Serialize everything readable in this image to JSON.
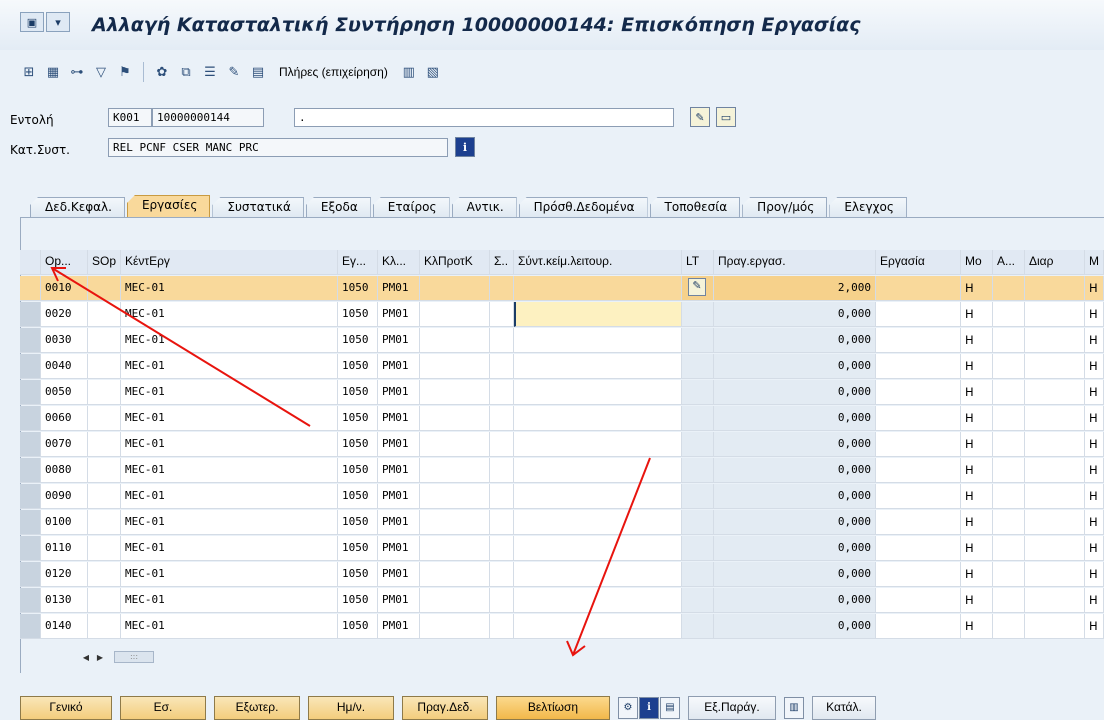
{
  "window": {
    "title": "Αλλαγή Κατασταλτική Συντήρηση 10000000144: Επισκόπηση Εργασίας"
  },
  "toolbar": {
    "full_label": "Πλήρες (επιχείρηση)"
  },
  "header": {
    "order_label": "Εντολή",
    "order_type": "K001",
    "order_number": "10000000144",
    "order_text": ".",
    "status_label": "Κατ.Συστ.",
    "status_value": "REL  PCNF CSER MANC PRC"
  },
  "tabs": [
    {
      "label": "Δεδ.Κεφαλ."
    },
    {
      "label": "Εργασίες"
    },
    {
      "label": "Συστατικά"
    },
    {
      "label": "Εξοδα"
    },
    {
      "label": "Εταίρος"
    },
    {
      "label": "Αντικ."
    },
    {
      "label": "Πρόσθ.Δεδομένα"
    },
    {
      "label": "Τοποθεσία"
    },
    {
      "label": "Προγ/μός"
    },
    {
      "label": "Ελεγχος"
    }
  ],
  "table": {
    "columns": [
      "Op...",
      "SOp",
      "ΚέντΕργ",
      "Εγ...",
      "Κλ...",
      "ΚλΠροτΚ",
      "Σ..",
      "Σύντ.κείμ.λειτουρ.",
      "LT",
      "Πραγ.εργασ.",
      "Εργασία",
      "Mo",
      "A...",
      "Διαρ",
      "M"
    ],
    "rows": [
      {
        "op": "0010",
        "work_center": "MEC-01",
        "plant": "1050",
        "ctrl": "PM01",
        "actual": "2,000",
        "unit": "H",
        "extra": "H"
      },
      {
        "op": "0020",
        "work_center": "MEC-01",
        "plant": "1050",
        "ctrl": "PM01",
        "actual": "0,000",
        "unit": "H",
        "extra": "H"
      },
      {
        "op": "0030",
        "work_center": "MEC-01",
        "plant": "1050",
        "ctrl": "PM01",
        "actual": "0,000",
        "unit": "H",
        "extra": "H"
      },
      {
        "op": "0040",
        "work_center": "MEC-01",
        "plant": "1050",
        "ctrl": "PM01",
        "actual": "0,000",
        "unit": "H",
        "extra": "H"
      },
      {
        "op": "0050",
        "work_center": "MEC-01",
        "plant": "1050",
        "ctrl": "PM01",
        "actual": "0,000",
        "unit": "H",
        "extra": "H"
      },
      {
        "op": "0060",
        "work_center": "MEC-01",
        "plant": "1050",
        "ctrl": "PM01",
        "actual": "0,000",
        "unit": "H",
        "extra": "H"
      },
      {
        "op": "0070",
        "work_center": "MEC-01",
        "plant": "1050",
        "ctrl": "PM01",
        "actual": "0,000",
        "unit": "H",
        "extra": "H"
      },
      {
        "op": "0080",
        "work_center": "MEC-01",
        "plant": "1050",
        "ctrl": "PM01",
        "actual": "0,000",
        "unit": "H",
        "extra": "H"
      },
      {
        "op": "0090",
        "work_center": "MEC-01",
        "plant": "1050",
        "ctrl": "PM01",
        "actual": "0,000",
        "unit": "H",
        "extra": "H"
      },
      {
        "op": "0100",
        "work_center": "MEC-01",
        "plant": "1050",
        "ctrl": "PM01",
        "actual": "0,000",
        "unit": "H",
        "extra": "H"
      },
      {
        "op": "0110",
        "work_center": "MEC-01",
        "plant": "1050",
        "ctrl": "PM01",
        "actual": "0,000",
        "unit": "H",
        "extra": "H"
      },
      {
        "op": "0120",
        "work_center": "MEC-01",
        "plant": "1050",
        "ctrl": "PM01",
        "actual": "0,000",
        "unit": "H",
        "extra": "H"
      },
      {
        "op": "0130",
        "work_center": "MEC-01",
        "plant": "1050",
        "ctrl": "PM01",
        "actual": "0,000",
        "unit": "H",
        "extra": "H"
      },
      {
        "op": "0140",
        "work_center": "MEC-01",
        "plant": "1050",
        "ctrl": "PM01",
        "actual": "0,000",
        "unit": "H",
        "extra": "H"
      }
    ]
  },
  "bottom_buttons": [
    "Γενικό",
    "Εσ.",
    "Εξωτερ.",
    "Ημ/ν.",
    "Πραγ.Δεδ.",
    "Βελτίωση"
  ],
  "bottom_buttons_after_icons": [
    "Εξ.Παράγ.",
    "Κατάλ."
  ],
  "colors": {
    "selected_row": "#f9d99b",
    "annotation_arrow": "#e8140e"
  }
}
